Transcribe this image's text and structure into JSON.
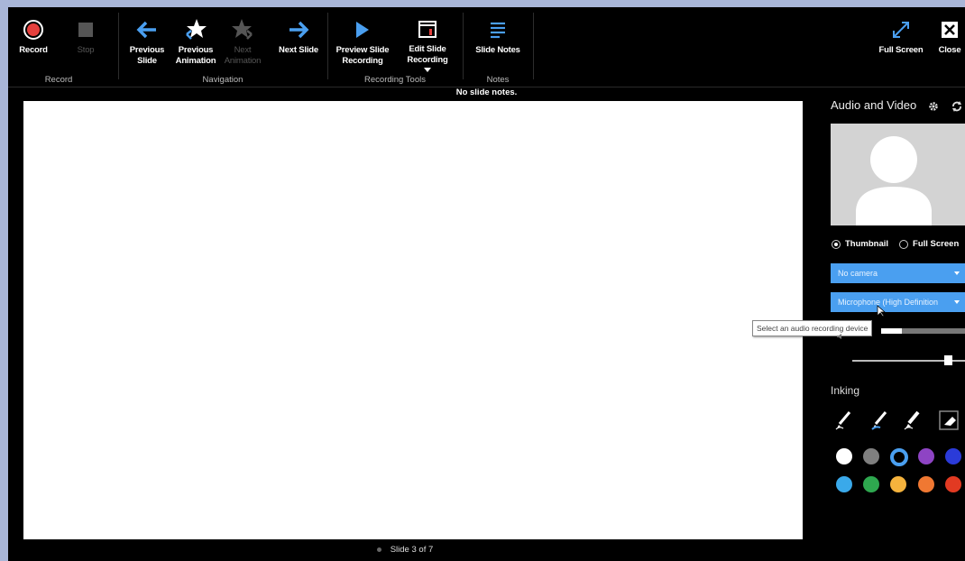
{
  "ribbon": {
    "record_label": "Record",
    "stop_label": "Stop",
    "prev_slide_label": "Previous Slide",
    "prev_anim_label": "Previous Animation",
    "next_anim_label": "Next Animation",
    "next_slide_label": "Next Slide",
    "preview_label": "Preview Slide Recording",
    "edit_label": "Edit Slide Recording",
    "notes_label": "Slide Notes",
    "fullscreen_label": "Full Screen",
    "close_label": "Close",
    "groups": {
      "record": "Record",
      "navigation": "Navigation",
      "recording_tools": "Recording Tools",
      "notes": "Notes"
    }
  },
  "notes_text": "No slide notes.",
  "status": {
    "slide_indicator": "Slide 3 of 7"
  },
  "panel": {
    "title": "Audio and Video",
    "radio_thumbnail": "Thumbnail",
    "radio_fullscreen": "Full Screen",
    "selected_view": "Thumbnail",
    "camera_select": "No camera",
    "mic_select": "Microphone (High Definition",
    "tooltip": "Select an audio recording device",
    "audio_level": 0.25,
    "volume_level": 0.85,
    "inking_title": "Inking"
  },
  "colors": {
    "accent": "#4a9ff0",
    "record_red": "#e5403d",
    "swatches_row1": [
      "#ffffff",
      "#7f7f7f",
      "#000000",
      "#8e44c4",
      "#2b3bd9"
    ],
    "swatches_row2": [
      "#3aa9ea",
      "#2ea84f",
      "#f5b33d",
      "#f07832",
      "#e23a22"
    ]
  }
}
